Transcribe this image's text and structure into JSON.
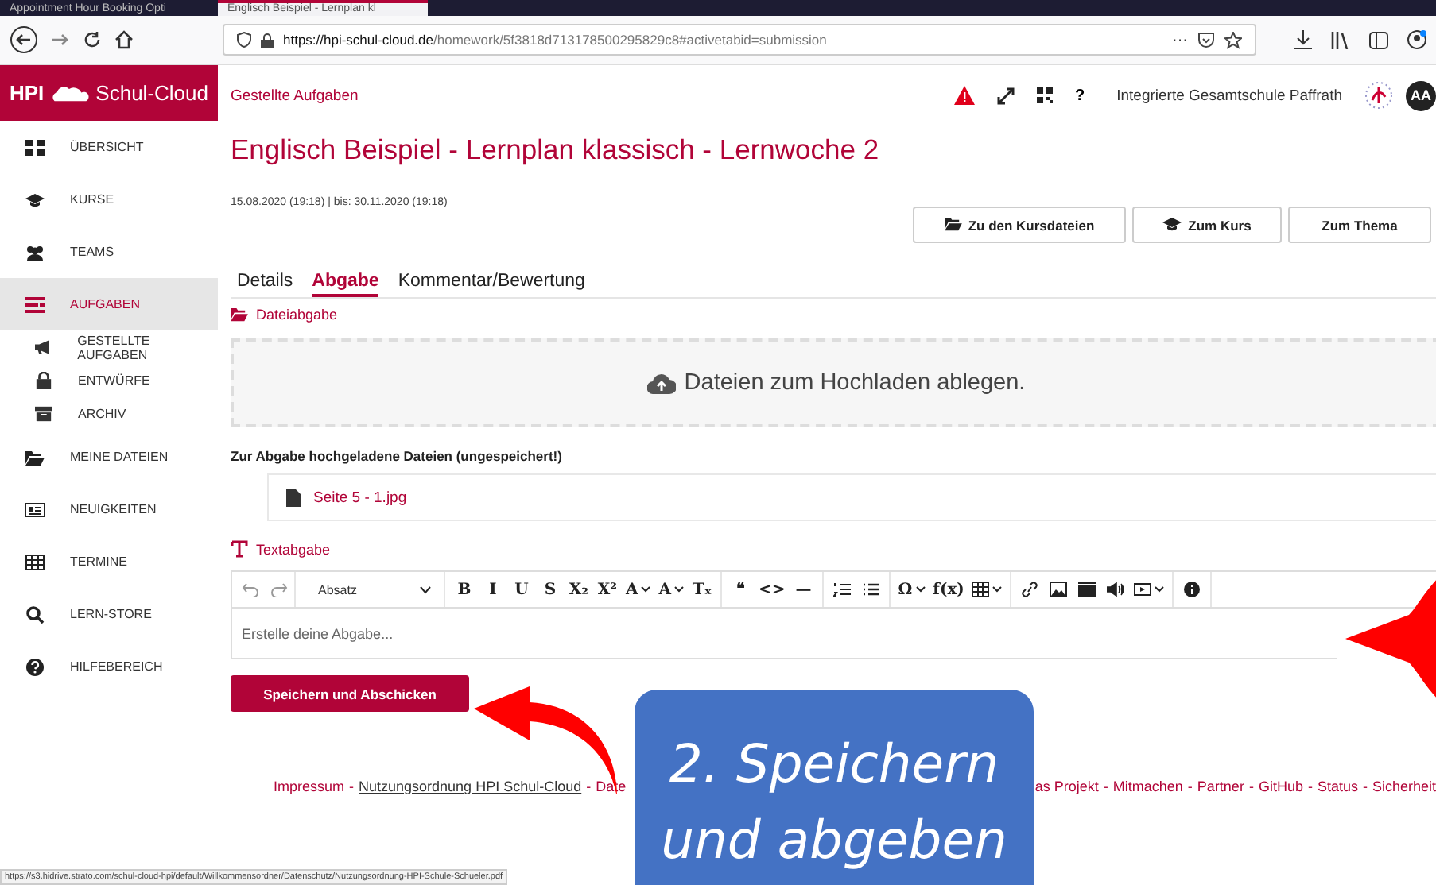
{
  "browser": {
    "tabs": [
      {
        "title": "Appointment Hour Booking Opti",
        "selected": false
      },
      {
        "title": "Englisch Beispiel - Lernplan kl",
        "selected": true
      }
    ],
    "url_host": "https://hpi-schul-cloud.de",
    "url_path": "/homework/5f3818d713178500295829c8#activetabid=submission",
    "menu": "···"
  },
  "sidebar": {
    "logo_left": "HPI",
    "logo_right": "Schul-Cloud",
    "items": [
      {
        "label": "ÜBERSICHT",
        "kind": "grid",
        "selected": false
      },
      {
        "label": "KURSE",
        "kind": "cap",
        "selected": false
      },
      {
        "label": "TEAMS",
        "kind": "people",
        "selected": false
      },
      {
        "label": "AUFGABEN",
        "kind": "tasks",
        "selected": true,
        "children": [
          {
            "label": "GESTELLTE AUFGABEN",
            "kind": "megaphone",
            "selected": false
          },
          {
            "label": "ENTWÜRFE",
            "kind": "lock",
            "selected": false
          },
          {
            "label": "ARCHIV",
            "kind": "archive",
            "selected": false
          }
        ]
      },
      {
        "label": "MEINE DATEIEN",
        "kind": "folder",
        "selected": false
      },
      {
        "label": "NEUIGKEITEN",
        "kind": "news",
        "selected": false
      },
      {
        "label": "TERMINE",
        "kind": "calendar",
        "selected": false
      },
      {
        "label": "LERN-STORE",
        "kind": "search",
        "selected": false
      },
      {
        "label": "HILFEBEREICH",
        "kind": "help",
        "selected": false
      }
    ]
  },
  "header": {
    "breadcrumb": "Gestellte Aufgaben",
    "help": "?",
    "school": "Integrierte Gesamtschule Paffrath",
    "avatar": "AA"
  },
  "title": "Englisch Beispiel - Lernplan klassisch - Lernwoche 2",
  "dates": "15.08.2020 (19:18) | bis: 30.11.2020 (19:18)",
  "actions": [
    {
      "label": "Zu den Kursdateien",
      "kind": "folder"
    },
    {
      "label": "Zum Kurs",
      "kind": "cap"
    },
    {
      "label": "Zum Thema",
      "kind": "none"
    }
  ],
  "tabs": [
    {
      "label": "Details",
      "selected": false
    },
    {
      "label": "Abgabe",
      "selected": true
    },
    {
      "label": "Kommentar/Bewertung",
      "selected": false
    }
  ],
  "file_section": {
    "heading": "Dateiabgabe",
    "dropzone": "Dateien zum Hochladen ablegen.",
    "uploaded_heading": "Zur Abgabe hochgeladene Dateien (ungespeichert!)",
    "files": [
      "Seite 5 - 1.jpg"
    ]
  },
  "text_section": {
    "heading": "Textabgabe",
    "format": "Absatz",
    "placeholder": "Erstelle deine Abgabe...",
    "toolbar": [
      [
        {
          "kind": "undo"
        },
        {
          "kind": "redo"
        }
      ],
      [
        {
          "kind": "glyph",
          "text": "B"
        },
        {
          "kind": "glyph",
          "text": "I"
        },
        {
          "kind": "glyph",
          "text": "U"
        },
        {
          "kind": "glyph",
          "text": "S"
        },
        {
          "kind": "glyph",
          "text": "X₂"
        },
        {
          "kind": "glyph",
          "text": "X²"
        },
        {
          "kind": "glyph",
          "text": "A",
          "dropdown": true
        },
        {
          "kind": "glyph",
          "text": "A",
          "dropdown": true
        },
        {
          "kind": "glyph",
          "text": "Tₓ"
        }
      ],
      [
        {
          "kind": "glyph",
          "text": "❝"
        },
        {
          "kind": "glyph",
          "text": "<>"
        },
        {
          "kind": "glyph",
          "text": "—"
        }
      ],
      [
        {
          "kind": "numbered"
        },
        {
          "kind": "bullets"
        }
      ],
      [
        {
          "kind": "glyph",
          "text": "Ω",
          "dropdown": true
        },
        {
          "kind": "glyph",
          "text": "f(x)"
        },
        {
          "kind": "table",
          "dropdown": true
        }
      ],
      [
        {
          "kind": "link"
        },
        {
          "kind": "image"
        },
        {
          "kind": "film"
        },
        {
          "kind": "audio"
        },
        {
          "kind": "media",
          "dropdown": true
        }
      ],
      [
        {
          "kind": "info"
        }
      ]
    ]
  },
  "submit": "Speichern und Abschicken",
  "footer": {
    "left": [
      "Impressum",
      "-",
      "Nutzungsordnung HPI Schul-Cloud",
      "-",
      "Date"
    ],
    "right": [
      "as Projekt",
      "-",
      "Mitmachen",
      "-",
      "Partner",
      "-",
      "GitHub",
      "-",
      "Status",
      "-",
      "Sicherheit"
    ]
  },
  "status_url": "https://s3.hidrive.strato.com/schul-cloud-hpi/default/Willkommensordner/Datenschutz/Nutzungsordnung-HPI-Schule-Schueler.pdf",
  "callout": [
    "2. Speichern",
    "und abgeben"
  ]
}
